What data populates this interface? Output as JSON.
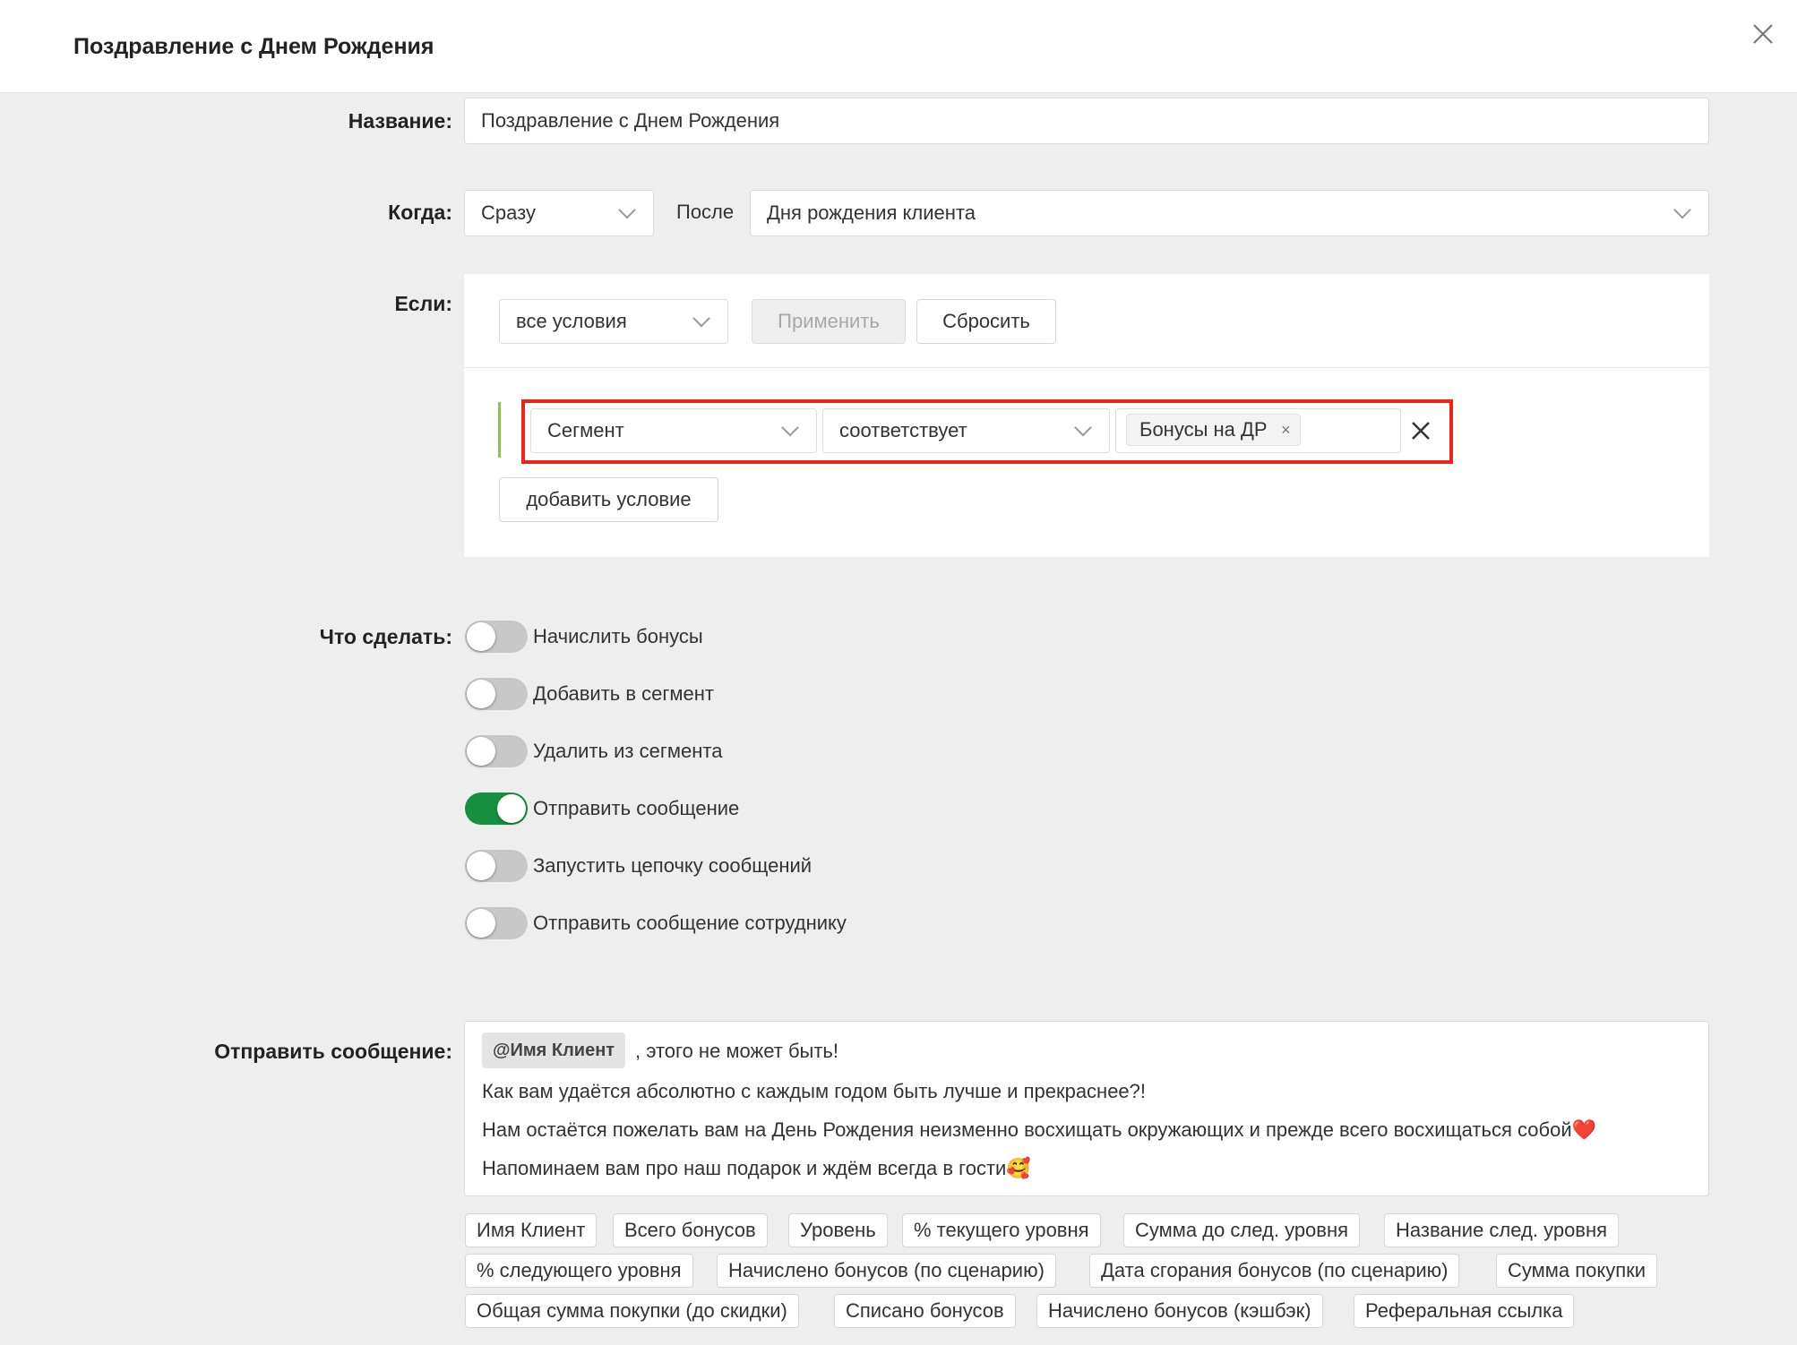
{
  "header": {
    "title": "Поздравление с Днем Рождения"
  },
  "form": {
    "name": {
      "label": "Название:",
      "value": "Поздравление с Днем Рождения"
    },
    "when": {
      "label": "Когда:",
      "timing_value": "Сразу",
      "after_label": "После",
      "event_value": "Дня рождения клиента"
    },
    "if": {
      "label": "Если:",
      "match_value": "все условия",
      "apply_label": "Применить",
      "reset_label": "Сбросить",
      "condition": {
        "field_value": "Сегмент",
        "operator_value": "соответствует",
        "tag_value": "Бонусы на ДР"
      },
      "add_condition_label": "добавить условие"
    },
    "actions": {
      "label": "Что сделать:",
      "items": [
        {
          "label": "Начислить бонусы",
          "on": false
        },
        {
          "label": "Добавить в сегмент",
          "on": false
        },
        {
          "label": "Удалить из сегмента",
          "on": false
        },
        {
          "label": "Отправить сообщение",
          "on": true
        },
        {
          "label": "Запустить цепочку сообщений",
          "on": false
        },
        {
          "label": "Отправить сообщение сотруднику",
          "on": false
        }
      ]
    },
    "message": {
      "label": "Отправить сообщение:",
      "mention": "@Имя Клиент",
      "line1_rest": ", этого не может быть!",
      "line2": "Как вам удаётся абсолютно с каждым годом быть лучше и прекраснее?!",
      "line3": "Нам остаётся пожелать вам на День Рождения неизменно восхищать окружающих и прежде всего восхищаться собой❤️",
      "line4": "Напоминаем вам про наш подарок и ждём всегда в гости🥰",
      "variables": [
        "Имя Клиент",
        "Всего бонусов",
        "Уровень",
        "% текущего уровня",
        "Сумма до след. уровня",
        "Название след. уровня",
        "% следующего уровня",
        "Начислено бонусов (по сценарию)",
        "Дата сгорания бонусов (по сценарию)",
        "Сумма покупки",
        "Общая сумма покупки (до скидки)",
        "Списано бонусов",
        "Начислено бонусов (кэшбэк)",
        "Реферальная ссылка"
      ]
    }
  },
  "colors": {
    "accent_green": "#14903e",
    "highlight_red": "#e8261c"
  }
}
